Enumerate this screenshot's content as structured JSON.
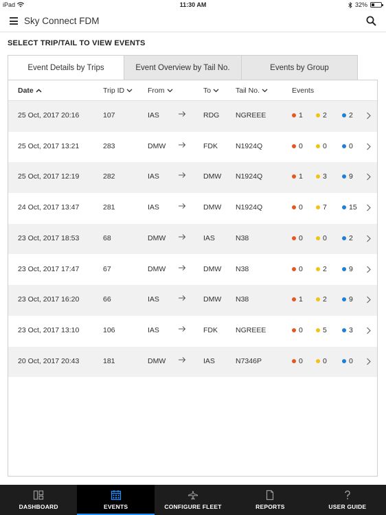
{
  "status_bar": {
    "device": "iPad",
    "time": "11:30 AM",
    "battery": "32%",
    "battery_fraction": 0.32
  },
  "app": {
    "title": "Sky Connect FDM"
  },
  "section_title": "SELECT TRIP/TAIL TO VIEW EVENTS",
  "tabs": [
    {
      "label": "Event Details by Trips",
      "active": true
    },
    {
      "label": "Event Overview by Tail No.",
      "active": false
    },
    {
      "label": "Events by Group",
      "active": false
    }
  ],
  "columns": {
    "date": "Date",
    "trip_id": "Trip ID",
    "from": "From",
    "to": "To",
    "tail_no": "Tail No.",
    "events": "Events"
  },
  "event_colors": {
    "red": "#e8561f",
    "yellow": "#f2c215",
    "blue": "#1e7fd6"
  },
  "rows": [
    {
      "date": "25 Oct, 2017 20:16",
      "trip_id": "107",
      "from": "IAS",
      "to": "RDG",
      "tail": "NGREEE",
      "red": "1",
      "yellow": "2",
      "blue": "2"
    },
    {
      "date": "25 Oct, 2017 13:21",
      "trip_id": "283",
      "from": "DMW",
      "to": "FDK",
      "tail": "N1924Q",
      "red": "0",
      "yellow": "0",
      "blue": "0"
    },
    {
      "date": "25 Oct, 2017 12:19",
      "trip_id": "282",
      "from": "IAS",
      "to": "DMW",
      "tail": "N1924Q",
      "red": "1",
      "yellow": "3",
      "blue": "9"
    },
    {
      "date": "24 Oct, 2017 13:47",
      "trip_id": "281",
      "from": "IAS",
      "to": "DMW",
      "tail": "N1924Q",
      "red": "0",
      "yellow": "7",
      "blue": "15"
    },
    {
      "date": "23 Oct, 2017 18:53",
      "trip_id": "68",
      "from": "DMW",
      "to": "IAS",
      "tail": "N38",
      "red": "0",
      "yellow": "0",
      "blue": "2"
    },
    {
      "date": "23 Oct, 2017 17:47",
      "trip_id": "67",
      "from": "DMW",
      "to": "DMW",
      "tail": "N38",
      "red": "0",
      "yellow": "2",
      "blue": "9"
    },
    {
      "date": "23 Oct, 2017 16:20",
      "trip_id": "66",
      "from": "IAS",
      "to": "DMW",
      "tail": "N38",
      "red": "1",
      "yellow": "2",
      "blue": "9"
    },
    {
      "date": "23 Oct, 2017 13:10",
      "trip_id": "106",
      "from": "IAS",
      "to": "FDK",
      "tail": "NGREEE",
      "red": "0",
      "yellow": "5",
      "blue": "3"
    },
    {
      "date": "20 Oct, 2017 20:43",
      "trip_id": "181",
      "from": "DMW",
      "to": "IAS",
      "tail": "N7346P",
      "red": "0",
      "yellow": "0",
      "blue": "0"
    }
  ],
  "bottom_tabs": [
    {
      "label": "DASHBOARD",
      "icon": "dashboard-icon",
      "active": false
    },
    {
      "label": "EVENTS",
      "icon": "calendar-icon",
      "active": true
    },
    {
      "label": "CONFIGURE FLEET",
      "icon": "aircraft-icon",
      "active": false
    },
    {
      "label": "REPORTS",
      "icon": "document-icon",
      "active": false
    },
    {
      "label": "USER GUIDE",
      "icon": "help-icon",
      "active": false
    }
  ]
}
